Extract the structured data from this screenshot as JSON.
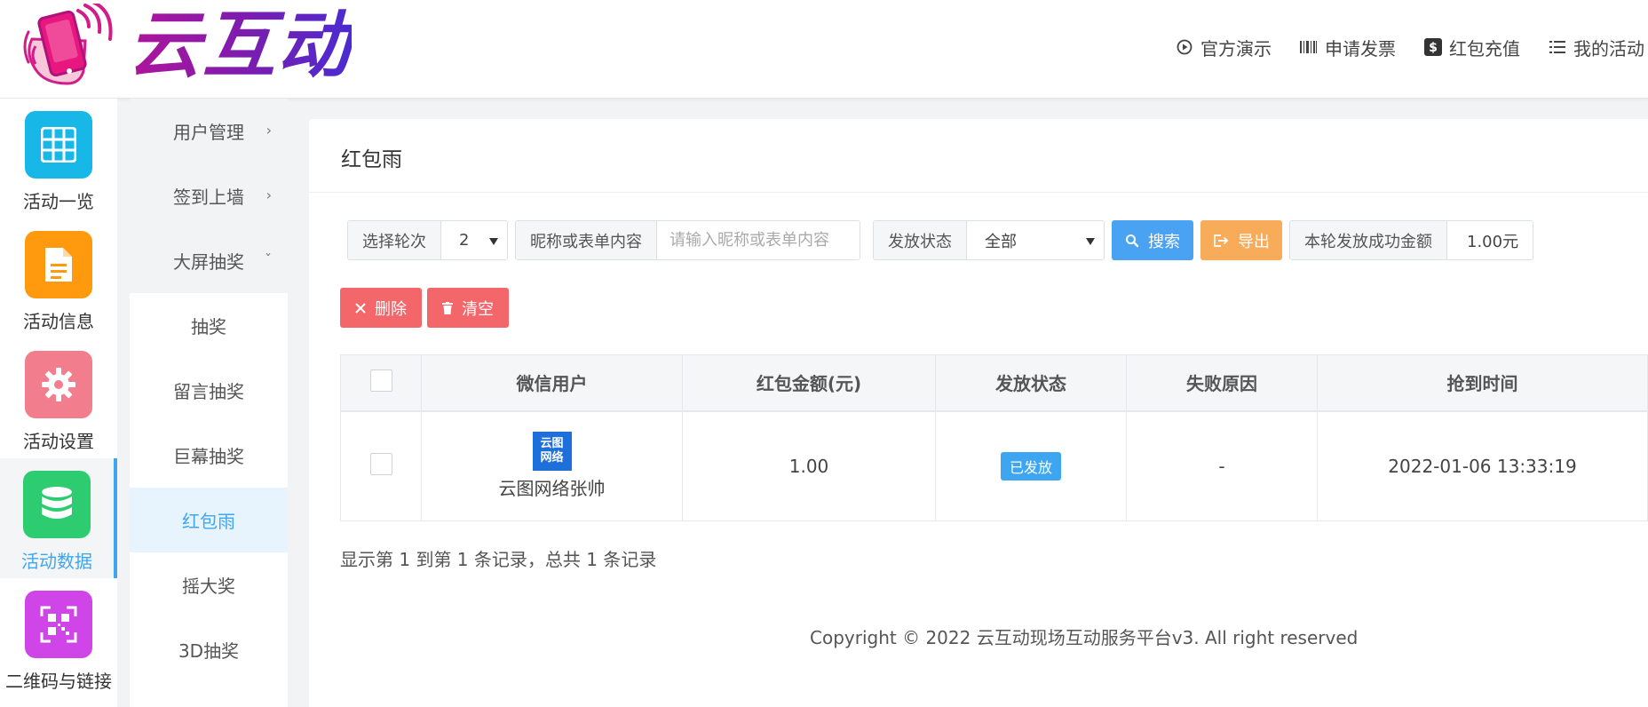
{
  "brand": {
    "logo_text": "云互动"
  },
  "top_nav": [
    {
      "label": "官方演示",
      "icon": "play-circle-icon"
    },
    {
      "label": "申请发票",
      "icon": "barcode-icon"
    },
    {
      "label": "红包充值",
      "icon": "dollar-icon"
    },
    {
      "label": "我的活动",
      "icon": "list-icon"
    }
  ],
  "sidebar": {
    "items": [
      {
        "label": "活动一览",
        "icon": "grid-icon",
        "color": "#17b8e8"
      },
      {
        "label": "活动信息",
        "icon": "document-icon",
        "color": "#ff9a0e"
      },
      {
        "label": "活动设置",
        "icon": "gear-icon",
        "color": "#f27e8d"
      },
      {
        "label": "活动数据",
        "icon": "database-icon",
        "color": "#2ecc71",
        "active": true
      },
      {
        "label": "二维码与链接",
        "icon": "qrcode-icon",
        "color": "#cf45e8"
      }
    ]
  },
  "subnav": {
    "items": [
      {
        "label": "用户管理",
        "chevron": "›"
      },
      {
        "label": "签到上墙",
        "chevron": "›"
      },
      {
        "label": "大屏抽奖",
        "chevron": "ˇ"
      },
      {
        "label": "抽奖"
      },
      {
        "label": "留言抽奖"
      },
      {
        "label": "巨幕抽奖"
      },
      {
        "label": "红包雨",
        "active": true
      },
      {
        "label": "摇大奖"
      },
      {
        "label": "3D抽奖"
      }
    ]
  },
  "panel": {
    "title": "红包雨",
    "filters": {
      "round_label": "选择轮次",
      "round_value": "2",
      "keyword_label": "昵称或表单内容",
      "keyword_placeholder": "请输入昵称或表单内容",
      "status_label": "发放状态",
      "status_value": "全部",
      "search_label": "搜索",
      "export_label": "导出",
      "amount_label": "本轮发放成功金额",
      "amount_value": "1.00元"
    },
    "actions": {
      "delete_label": "删除",
      "clear_label": "清空"
    },
    "table": {
      "columns": [
        "微信用户",
        "红包金额(元)",
        "发放状态",
        "失败原因",
        "抢到时间"
      ],
      "rows": [
        {
          "avatar_line1": "云图",
          "avatar_line2": "网络",
          "user": "云图网络张帅",
          "amount": "1.00",
          "status": "已发放",
          "reason": "-",
          "time": "2022-01-06 13:33:19"
        }
      ]
    },
    "summary": "显示第 1 到第 1 条记录，总共 1 条记录",
    "footer": "Copyright © 2022 云互动现场互动服务平台v3. All right reserved"
  },
  "colors": {
    "accent": "#3ea6f0",
    "danger": "#f3676a",
    "warning": "#f8ac59",
    "primary": "#4aa3f2"
  }
}
